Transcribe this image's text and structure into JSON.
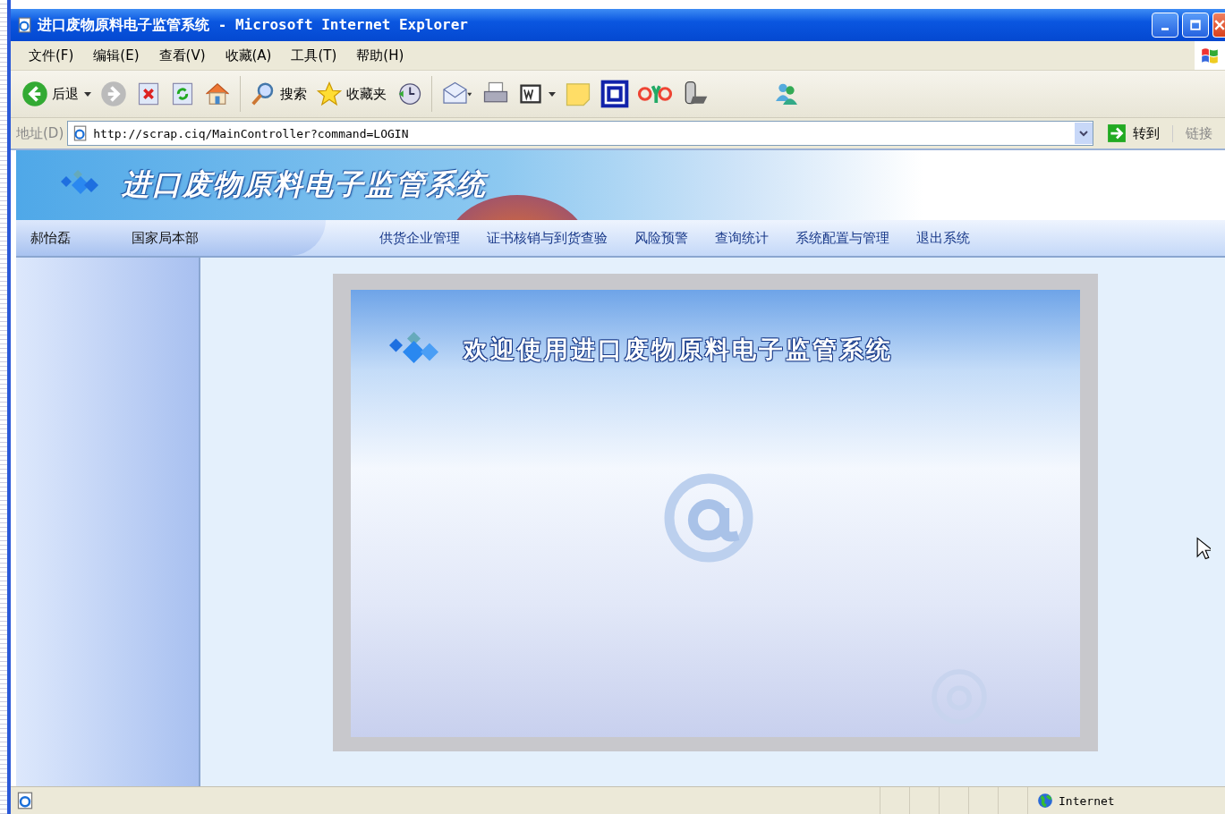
{
  "window": {
    "title": "进口废物原料电子监管系统 - Microsoft Internet Explorer"
  },
  "menu": [
    "文件(F)",
    "编辑(E)",
    "查看(V)",
    "收藏(A)",
    "工具(T)",
    "帮助(H)"
  ],
  "toolbar": {
    "back": "后退",
    "search": "搜索",
    "favorites": "收藏夹"
  },
  "address_bar": {
    "label": "地址(D)",
    "url": "http://scrap.ciq/MainController?command=LOGIN",
    "go": "转到",
    "links": "链接"
  },
  "banner": {
    "title": "进口废物原料电子监管系统"
  },
  "user_bar": {
    "user": "郝怡磊",
    "department": "国家局本部"
  },
  "nav": [
    "供货企业管理",
    "证书核销与到货查验",
    "风险预警",
    "查询统计",
    "系统配置与管理",
    "退出系统"
  ],
  "welcome": {
    "title": "欢迎使用进口废物原料电子监管系统"
  },
  "status_bar": {
    "zone": "Internet"
  }
}
